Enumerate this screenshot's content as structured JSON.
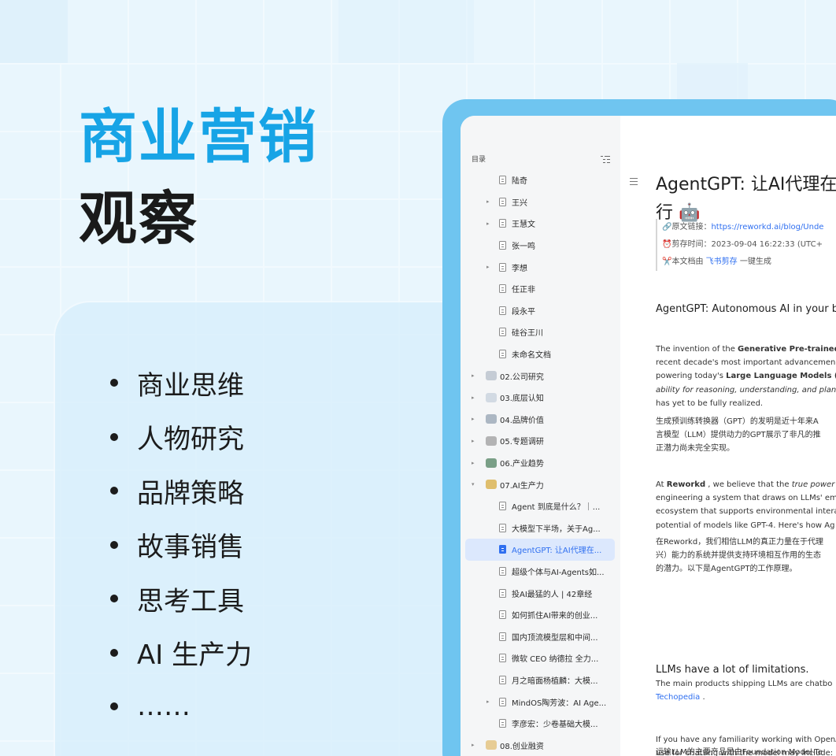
{
  "headline": {
    "line1": "商业营销",
    "line2": "观察"
  },
  "features": [
    "商业思维",
    "人物研究",
    "品牌策略",
    "故事销售",
    "思考工具",
    "AI 生产力",
    "……"
  ],
  "sidebar": {
    "title": "目录",
    "items": [
      {
        "label": "陆奇",
        "type": "doc",
        "expand": false
      },
      {
        "label": "王兴",
        "type": "doc",
        "expand": true
      },
      {
        "label": "王慧文",
        "type": "doc",
        "expand": true
      },
      {
        "label": "张一鸣",
        "type": "doc",
        "expand": false
      },
      {
        "label": "李想",
        "type": "doc",
        "expand": true
      },
      {
        "label": "任正非",
        "type": "doc",
        "expand": false
      },
      {
        "label": "段永平",
        "type": "doc",
        "expand": false
      },
      {
        "label": "硅谷王川",
        "type": "doc",
        "expand": false
      },
      {
        "label": "未命名文档",
        "type": "doc",
        "expand": false
      },
      {
        "label": "02.公司研究",
        "type": "folder",
        "icon": "folder-icon",
        "color": "#b9c2cc"
      },
      {
        "label": "03.底层认知",
        "type": "folder",
        "icon": "snowflake-icon",
        "color": "#c9d3dd"
      },
      {
        "label": "04.品牌价值",
        "type": "folder",
        "icon": "butterfly-icon",
        "color": "#9aa7b5"
      },
      {
        "label": "05.专题调研",
        "type": "folder",
        "icon": "wrench-icon",
        "color": "#a3a3a3"
      },
      {
        "label": "06.产业趋势",
        "type": "folder",
        "icon": "plant-icon",
        "color": "#5b8a6a"
      },
      {
        "label": "07.AI生产力",
        "type": "folder",
        "icon": "magic-wand-icon",
        "color": "#d9b04a",
        "open": true
      },
      {
        "label": "Agent 到底是什么？｜...",
        "type": "doc",
        "expand": false
      },
      {
        "label": "大模型下半场，关于Ag...",
        "type": "doc",
        "expand": false
      },
      {
        "label": "AgentGPT: 让AI代理在...",
        "type": "doc",
        "expand": false,
        "active": true
      },
      {
        "label": "超级个体与AI-Agents如...",
        "type": "doc",
        "expand": false
      },
      {
        "label": "投AI最猛的人 | 42章经",
        "type": "doc",
        "expand": false
      },
      {
        "label": "如何抓住AI带来的创业...",
        "type": "doc",
        "expand": false
      },
      {
        "label": "国内顶流模型层和中间...",
        "type": "doc",
        "expand": false
      },
      {
        "label": "微软 CEO 纳德拉 全力...",
        "type": "doc",
        "expand": false
      },
      {
        "label": "月之暗面杨植麟：大模...",
        "type": "doc",
        "expand": false
      },
      {
        "label": "MindOS陶芳波：AI Age...",
        "type": "doc",
        "expand": true
      },
      {
        "label": "李彦宏：少卷基础大模...",
        "type": "doc",
        "expand": false
      },
      {
        "label": "08.创业融资",
        "type": "folder",
        "icon": "moon-icon",
        "color": "#e3c27a"
      }
    ]
  },
  "document": {
    "title_line1": "AgentGPT: 让AI代理在",
    "title_line2": "行 🤖",
    "meta": {
      "source_label": "🔗原文链接：",
      "source_url": "https://reworkd.ai/blog/Unde",
      "time_label": "⏰剪存时间：",
      "time_value": "2023-09-04 16:22:33 (UTC+",
      "gen_prefix": "✂️本文档由 ",
      "gen_link": "飞书剪存",
      "gen_suffix": " 一键生成"
    },
    "section1_heading": "AgentGPT: Autonomous AI in your b",
    "para1_en": {
      "l1a": "The invention of the ",
      "l1b": "Generative Pre-trained",
      "l2": "recent decade's most important advancemen",
      "l3a": "powering today's ",
      "l3b": "Large Language Models (",
      "l4": "ability for reasoning, understanding, and plan",
      "l5": "has yet to be fully realized."
    },
    "para1_zh": [
      "生成预训练转换器（GPT）的发明是近十年来A",
      "言模型（LLM）提供动力的GPT展示了非凡的推",
      "正潜力尚未完全实现。"
    ],
    "para2_en": {
      "l1a": "At ",
      "l1b": "Reworkd",
      "l1c": " , we believe that the ",
      "l1d": "true power",
      "l2": "engineering a system that draws on LLMs' em",
      "l3": "ecosystem that supports environmental intera",
      "l4": "potential of models like GPT-4. Here's how Ag"
    },
    "para2_zh": [
      "在Reworkd，我们相信LLM的真正力量在于代理",
      "兴）能力的系统并提供支持环境相互作用的生态",
      "的潜力。以下是AgentGPT的工作原理。"
    ],
    "section2_heading": "LLMs have a lot of limitations.",
    "para3_en_l1": "The main products shipping LLMs are chatbo",
    "para3_link": "Techopedia",
    "para3_link_suffix": " .",
    "para4_en": "If you have any familiarity working with OpenA",
    "para4_en_l2": "use for chatting with the model may include:",
    "para4_zh": "运输LLM的主要产品是由Foundation Model-Te"
  }
}
